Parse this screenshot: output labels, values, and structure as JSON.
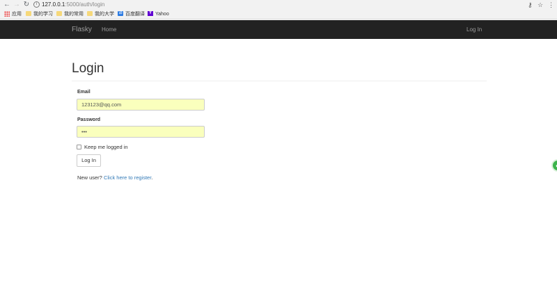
{
  "browser": {
    "url_host": "127.0.0.1",
    "url_path": ":5000/auth/login",
    "bookmarks": [
      {
        "label": "应用",
        "icon": "apps-grid-icon"
      },
      {
        "label": "我的学习",
        "icon": "folder-icon"
      },
      {
        "label": "我的常用",
        "icon": "folder-icon"
      },
      {
        "label": "我的大学",
        "icon": "folder-icon"
      },
      {
        "label": "百度翻译",
        "icon": "baidu-translate-icon"
      },
      {
        "label": "Yahoo",
        "icon": "yahoo-icon"
      }
    ]
  },
  "navbar": {
    "brand": "Flasky",
    "home": "Home",
    "login": "Log In",
    "background": "#222222",
    "text_color": "#9d9d9d"
  },
  "page": {
    "title": "Login"
  },
  "form": {
    "email_label": "Email",
    "email_value": "123123@qq.com",
    "password_label": "Password",
    "password_value": "•••",
    "remember_label": "Keep me logged in",
    "remember_checked": false,
    "submit_label": "Log In",
    "autofill_color": "#faffbd"
  },
  "footer": {
    "new_user_text": "New user?",
    "register_link": "Click here to register",
    "register_suffix": ".",
    "link_color": "#337ab7"
  }
}
